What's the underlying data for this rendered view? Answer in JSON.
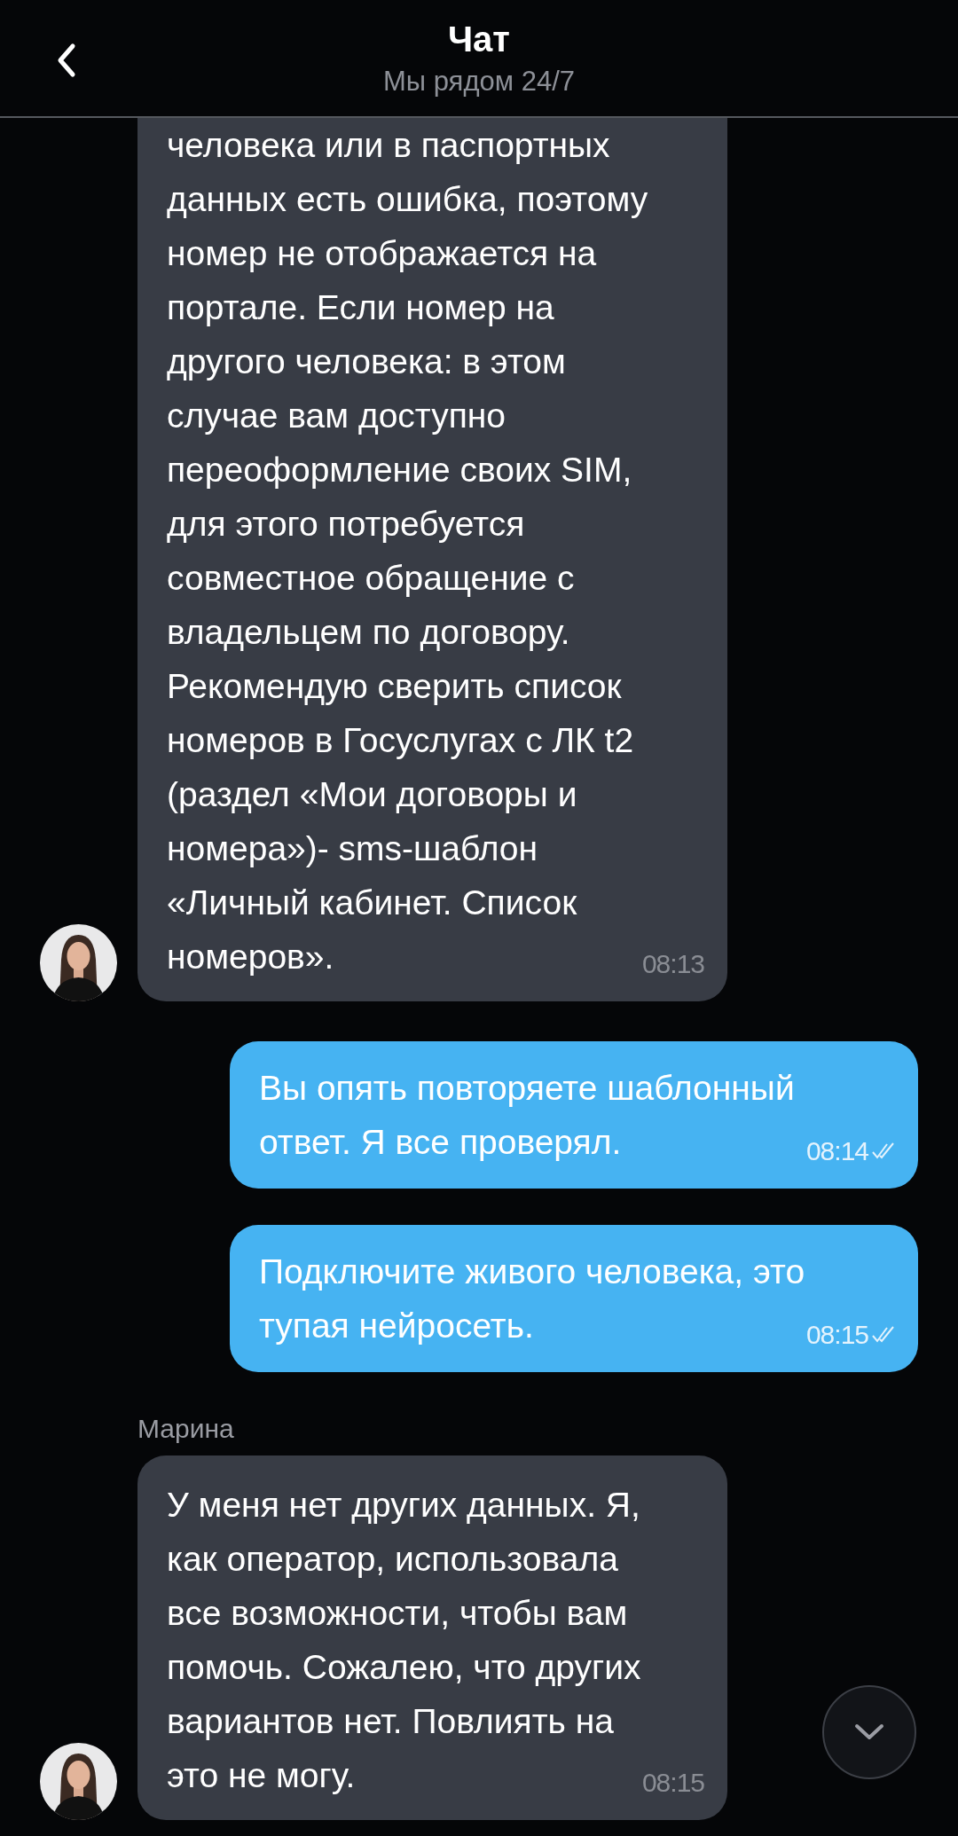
{
  "header": {
    "title": "Чат",
    "subtitle": "Мы рядом 24/7"
  },
  "messages": [
    {
      "kind": "incoming",
      "cut_top": true,
      "avatar": true,
      "text": "человека или в паспортных\nданных есть ошибка, поэтому\nномер не отображается на\nпортале. Если номер на\nдругого человека: в этом\nслучае вам доступно\nпереоформление своих SIM,\nдля этого потребуется\nсовместное обращение с\nвладельцем по договору.\nРекомендую сверить список\nномеров в Госуслугах с ЛК t2\n(раздел «Мои договоры и\nномера»)- sms-шаблон\n«Личный кабинет. Список\nномеров».",
      "time": "08:13"
    },
    {
      "kind": "outgoing",
      "delivered": true,
      "text": "Вы опять повторяете шаблонный\nответ. Я все проверял.",
      "time": "08:14"
    },
    {
      "kind": "outgoing",
      "delivered": true,
      "text": "Подключите живого человека, это\nтупая нейросеть.",
      "time": "08:15"
    },
    {
      "kind": "incoming",
      "cut_top": false,
      "avatar": true,
      "sender": "Марина",
      "text": "У меня нет других данных. Я,\nкак оператор, использовала\nвсе возможности, чтобы вам\nпомочь. Сожалею, что других\nвариантов нет. Повлиять на\nэто не могу.",
      "time": "08:15"
    }
  ]
}
